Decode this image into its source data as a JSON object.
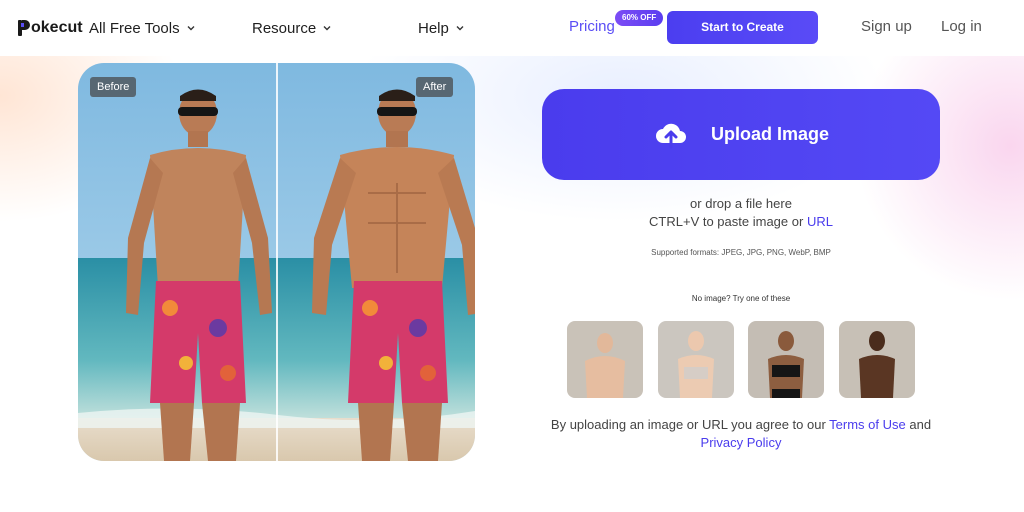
{
  "header": {
    "logo_text": "okecut",
    "nav": [
      {
        "label": "All Free Tools"
      },
      {
        "label": "Resource"
      },
      {
        "label": "Help"
      }
    ],
    "pricing_label": "Pricing",
    "discount_badge": "60% OFF",
    "start_button": "Start to Create",
    "signup_label": "Sign up",
    "login_label": "Log in"
  },
  "compare": {
    "before_label": "Before",
    "after_label": "After"
  },
  "upload": {
    "button_label": "Upload Image",
    "drop_text": "or drop a file here",
    "paste_text": "CTRL+V to paste image or",
    "url_link": "URL",
    "formats_text": "Supported formats: JPEG, JPG, PNG, WebP, BMP",
    "try_text": "No image? Try one of these"
  },
  "agreement": {
    "prefix": "By uploading an image or URL you agree to our",
    "terms_link": "Terms of Use",
    "middle": "and",
    "privacy_link": "Privacy Policy"
  },
  "colors": {
    "brand": "#4a3ced",
    "pricing": "#5b4ef5",
    "badge": "#7c4cf5"
  },
  "icons": {
    "logo": "pokecut-logo",
    "chevron": "chevron-down-icon",
    "upload": "cloud-upload-icon"
  }
}
